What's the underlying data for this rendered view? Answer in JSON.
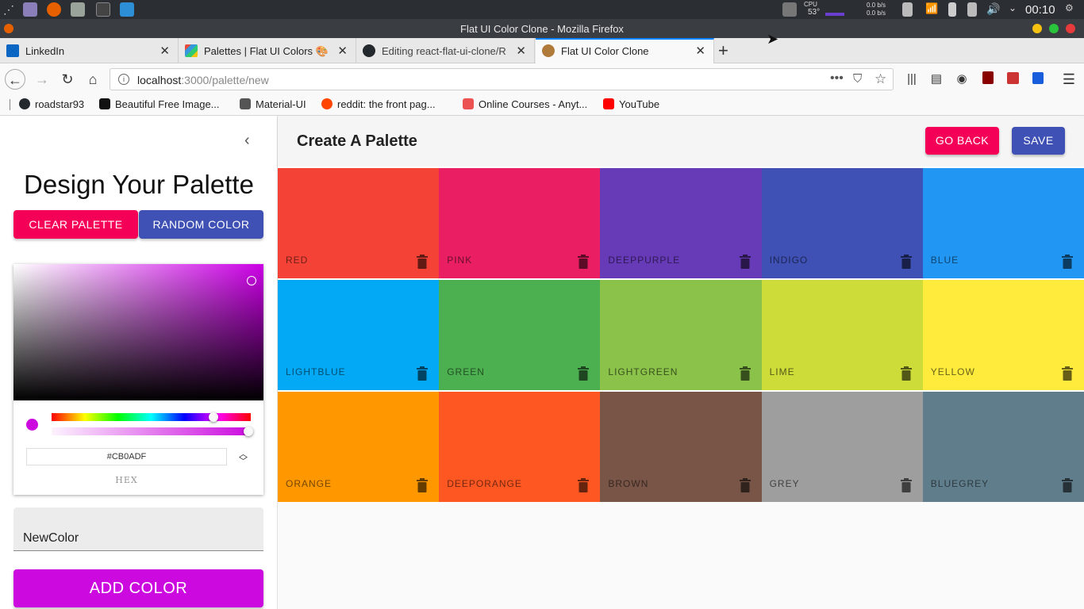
{
  "os": {
    "cpu_label": "CPU",
    "cpu_temp": "53°",
    "net_down": "0.0 b/s",
    "net_up": "0.0 b/s",
    "clock": "00:10"
  },
  "window": {
    "title": "Flat UI Color Clone - Mozilla Firefox"
  },
  "tabs": [
    {
      "label": "LinkedIn",
      "active": false
    },
    {
      "label": "Palettes | Flat UI Colors 🎨",
      "active": false
    },
    {
      "label": "Editing react-flat-ui-clone/R",
      "active": false
    },
    {
      "label": "Flat UI Color Clone",
      "active": true
    }
  ],
  "nav": {
    "url_host": "localhost",
    "url_rest": ":3000/palette/new"
  },
  "bookmarks": [
    "roadstar93",
    "Beautiful Free Image...",
    "Material-UI",
    "reddit: the front pag...",
    "Online Courses - Anyt...",
    "YouTube"
  ],
  "drawer": {
    "title": "Design Your Palette",
    "clear_label": "CLEAR PALETTE",
    "random_label": "RANDOM COLOR",
    "hex_value": "#CB0ADF",
    "hex_label": "HEX",
    "name_value": "NewColor",
    "add_label": "ADD COLOR",
    "colors": {
      "clear": "#f50057",
      "random": "#3f51b5",
      "add": "#cc0adf"
    }
  },
  "app_bar": {
    "title": "Create A Palette",
    "go_back_label": "GO BACK",
    "save_label": "SAVE"
  },
  "palette": [
    {
      "name": "RED",
      "color": "#f44336"
    },
    {
      "name": "PINK",
      "color": "#e91e63"
    },
    {
      "name": "DEEPPURPLE",
      "color": "#673ab7"
    },
    {
      "name": "INDIGO",
      "color": "#3f51b5"
    },
    {
      "name": "BLUE",
      "color": "#2196f3"
    },
    {
      "name": "LIGHTBLUE",
      "color": "#03a9f4"
    },
    {
      "name": "GREEN",
      "color": "#4caf50"
    },
    {
      "name": "LIGHTGREEN",
      "color": "#8bc34a"
    },
    {
      "name": "LIME",
      "color": "#cddc39"
    },
    {
      "name": "YELLOW",
      "color": "#ffeb3b"
    },
    {
      "name": "ORANGE",
      "color": "#ff9800"
    },
    {
      "name": "DEEPORANGE",
      "color": "#ff5722"
    },
    {
      "name": "BROWN",
      "color": "#795548"
    },
    {
      "name": "GREY",
      "color": "#9e9e9e"
    },
    {
      "name": "BLUEGREY",
      "color": "#607d8b"
    }
  ]
}
